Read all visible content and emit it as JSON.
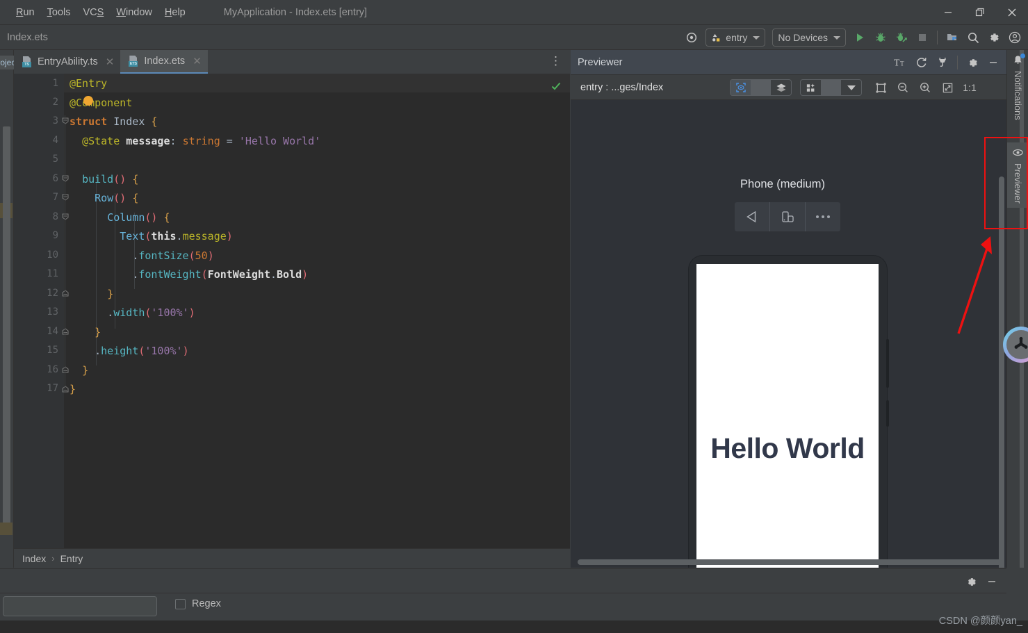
{
  "window": {
    "title": "MyApplication - Index.ets [entry]",
    "menu": [
      {
        "label": "Run",
        "mnemonic_index": 1
      },
      {
        "label": "Tools",
        "mnemonic_index": 0
      },
      {
        "label": "VCS",
        "mnemonic_index": 2
      },
      {
        "label": "Window",
        "mnemonic_index": 0
      },
      {
        "label": "Help",
        "mnemonic_index": 0
      }
    ],
    "controls": {
      "minimize": "minimize-icon",
      "maximize": "restore-icon",
      "close": "close-icon"
    }
  },
  "navbar": {
    "file_label": "Index.ets",
    "run_config": "entry",
    "device_selector": "No Devices",
    "icons": [
      "target-icon",
      "run-icon",
      "debug-icon",
      "attach-debugger-icon",
      "stop-icon",
      "project-structure-icon",
      "search-everywhere-icon",
      "settings-icon",
      "account-icon"
    ]
  },
  "editor": {
    "project_tab": "Project",
    "tabs": [
      {
        "label": "EntryAbility.ts",
        "badge": "TS",
        "active": false
      },
      {
        "label": "Index.ets",
        "badge": "ETS",
        "active": true
      }
    ],
    "line_numbers": [
      "1",
      "2",
      "3",
      "4",
      "5",
      "6",
      "7",
      "8",
      "9",
      "10",
      "11",
      "12",
      "13",
      "14",
      "15",
      "16",
      "17"
    ],
    "code": [
      "@Entry",
      "@Component",
      "struct Index {",
      "  @State message: string = 'Hello World'",
      "",
      "  build() {",
      "    Row() {",
      "      Column() {",
      "        Text(this.message)",
      "          .fontSize(50)",
      "          .fontWeight(FontWeight.Bold)",
      "      }",
      "      .width('100%')",
      "    }",
      "    .height('100%')",
      "  }",
      "}"
    ],
    "breadcrumb": [
      "Index",
      "Entry"
    ],
    "breadcrumb_separator": "›",
    "inspection_status": "no-errors-check-icon"
  },
  "previewer": {
    "title": "Previewer",
    "header_icons": [
      "font-size-icon",
      "refresh-icon",
      "plug-icon",
      "settings-icon",
      "minimize-icon"
    ],
    "subtitle": "entry : ...ges/Index",
    "toolbar_icons": [
      "inspector-icon",
      "layers-icon",
      "multi-device-icon",
      "chevron-down-icon",
      "frame-icon",
      "zoom-out-icon",
      "zoom-in-icon",
      "fit-screen-icon",
      "actual-size-icon"
    ],
    "zoom_actual_label": "1:1",
    "device_name": "Phone (medium)",
    "device_controls": [
      "rotate-back-icon",
      "orientation-icon",
      "more-icon"
    ],
    "screen_text": "Hello World"
  },
  "right_rail": {
    "items": [
      {
        "label": "Notifications",
        "icon": "bell-icon",
        "active": false,
        "badge": true
      },
      {
        "label": "Previewer",
        "icon": "eye-icon",
        "active": true,
        "badge": false
      }
    ],
    "logo": "harmonyos-logo"
  },
  "bottom": {
    "search_value": "",
    "search_placeholder": "",
    "regex_label": "Regex",
    "regex_checked": false,
    "icons": [
      "settings-icon",
      "minimize-icon"
    ]
  },
  "annotations": {
    "highlight_color": "#ee1111",
    "arrow": "red-arrow-pointing-to-previewer"
  },
  "watermark": "CSDN @颜颜yan_",
  "colors": {
    "window_bg": "#3c3f41",
    "editor_bg": "#2b2b2b",
    "gutter_bg": "#313335",
    "accent_blue": "#3a87d8",
    "run_green": "#59a869",
    "annotation_red": "#ee1111"
  }
}
